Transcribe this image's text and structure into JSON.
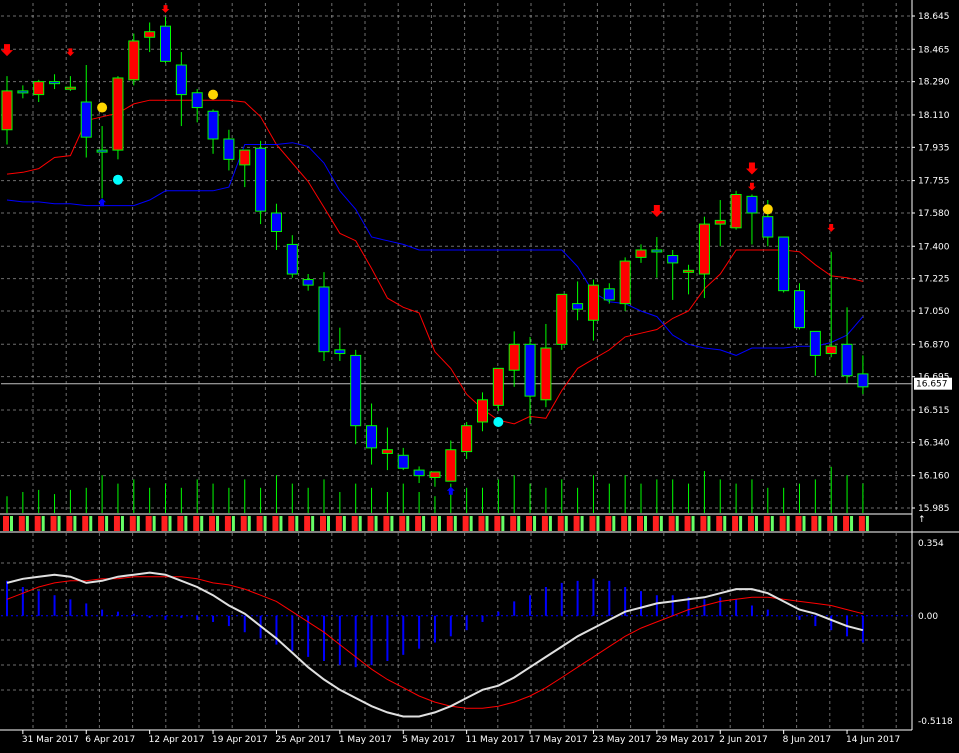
{
  "colors": {
    "background": "#000000",
    "grid": "#c8c8c8",
    "frame": "#ffffff",
    "bull_candle": "#ff0000",
    "bear_candle": "#0000ff",
    "wick": "#00ff00",
    "red_line": "#ff0000",
    "blue_line": "#0000ff",
    "volume": "#00ff00",
    "osc_signal": "#ffffff",
    "osc_histogram": "#0000ff",
    "up_arrow": "#0000ff",
    "down_arrow": "#ff0000",
    "yellow_dot": "#ffd700",
    "cyan_dot": "#00ffff"
  },
  "chart_data": [
    {
      "type": "candlestick",
      "panel": "price",
      "y_ticks": [
        "18.645",
        "18.465",
        "18.290",
        "18.110",
        "17.935",
        "17.755",
        "17.580",
        "17.400",
        "17.225",
        "17.050",
        "16.870",
        "16.695",
        "16.515",
        "16.340",
        "16.160",
        "15.985"
      ],
      "ylim": [
        15.985,
        18.645
      ],
      "current_price_label": "16.657",
      "candles": [
        {
          "o": 18.03,
          "h": 18.32,
          "c": 18.24,
          "l": 17.95
        },
        {
          "o": 18.24,
          "h": 18.27,
          "c": 18.23,
          "l": 18.2
        },
        {
          "o": 18.22,
          "h": 18.3,
          "c": 18.29,
          "l": 18.18
        },
        {
          "o": 18.29,
          "h": 18.33,
          "c": 18.28,
          "l": 18.25
        },
        {
          "o": 18.26,
          "h": 18.32,
          "c": 18.26,
          "l": 18.24
        },
        {
          "o": 18.18,
          "h": 18.38,
          "c": 17.99,
          "l": 17.88
        },
        {
          "o": 17.92,
          "h": 18.05,
          "c": 17.91,
          "l": 17.66
        },
        {
          "o": 17.92,
          "h": 18.32,
          "c": 18.31,
          "l": 17.87
        },
        {
          "o": 18.3,
          "h": 18.55,
          "c": 18.51,
          "l": 18.27
        },
        {
          "o": 18.53,
          "h": 18.61,
          "c": 18.56,
          "l": 18.45
        },
        {
          "o": 18.59,
          "h": 18.64,
          "c": 18.4,
          "l": 18.39
        },
        {
          "o": 18.38,
          "h": 18.45,
          "c": 18.22,
          "l": 18.05
        },
        {
          "o": 18.23,
          "h": 18.25,
          "c": 18.15,
          "l": 18.07
        },
        {
          "o": 18.13,
          "h": 18.14,
          "c": 17.98,
          "l": 17.9
        },
        {
          "o": 17.98,
          "h": 18.03,
          "c": 17.87,
          "l": 17.81
        },
        {
          "o": 17.84,
          "h": 17.88,
          "c": 17.92,
          "l": 17.72
        },
        {
          "o": 17.93,
          "h": 17.97,
          "c": 17.59,
          "l": 17.52
        },
        {
          "o": 17.58,
          "h": 17.63,
          "c": 17.48,
          "l": 17.38
        },
        {
          "o": 17.41,
          "h": 17.46,
          "c": 17.25,
          "l": 17.23
        },
        {
          "o": 17.22,
          "h": 17.25,
          "c": 17.19,
          "l": 17.16
        },
        {
          "o": 17.18,
          "h": 17.26,
          "c": 16.83,
          "l": 16.78
        },
        {
          "o": 16.84,
          "h": 16.96,
          "c": 16.82,
          "l": 16.78
        },
        {
          "o": 16.81,
          "h": 16.84,
          "c": 16.43,
          "l": 16.33
        },
        {
          "o": 16.43,
          "h": 16.55,
          "c": 16.31,
          "l": 16.22
        },
        {
          "o": 16.28,
          "h": 16.42,
          "c": 16.3,
          "l": 16.19
        },
        {
          "o": 16.27,
          "h": 16.31,
          "c": 16.2,
          "l": 16.19
        },
        {
          "o": 16.19,
          "h": 16.21,
          "c": 16.16,
          "l": 16.12
        },
        {
          "o": 16.15,
          "h": 16.17,
          "c": 16.18,
          "l": 16.1
        },
        {
          "o": 16.13,
          "h": 16.35,
          "c": 16.3,
          "l": 16.13
        },
        {
          "o": 16.29,
          "h": 16.45,
          "c": 16.43,
          "l": 16.25
        },
        {
          "o": 16.45,
          "h": 16.61,
          "c": 16.57,
          "l": 16.4
        },
        {
          "o": 16.54,
          "h": 16.71,
          "c": 16.74,
          "l": 16.51
        },
        {
          "o": 16.73,
          "h": 16.94,
          "c": 16.87,
          "l": 16.64
        },
        {
          "o": 16.87,
          "h": 16.91,
          "c": 16.59,
          "l": 16.44
        },
        {
          "o": 16.57,
          "h": 16.98,
          "c": 16.85,
          "l": 16.53
        },
        {
          "o": 16.87,
          "h": 17.12,
          "c": 17.14,
          "l": 16.84
        },
        {
          "o": 17.09,
          "h": 17.21,
          "c": 17.06,
          "l": 17.0
        },
        {
          "o": 17.0,
          "h": 17.22,
          "c": 17.19,
          "l": 16.89
        },
        {
          "o": 17.17,
          "h": 17.2,
          "c": 17.11,
          "l": 17.09
        },
        {
          "o": 17.09,
          "h": 17.34,
          "c": 17.32,
          "l": 17.05
        },
        {
          "o": 17.34,
          "h": 17.41,
          "c": 17.38,
          "l": 17.31
        },
        {
          "o": 17.38,
          "h": 17.45,
          "c": 17.37,
          "l": 17.23
        },
        {
          "o": 17.35,
          "h": 17.38,
          "c": 17.31,
          "l": 17.11
        },
        {
          "o": 17.27,
          "h": 17.3,
          "c": 17.27,
          "l": 17.14
        },
        {
          "o": 17.25,
          "h": 17.56,
          "c": 17.52,
          "l": 17.12
        },
        {
          "o": 17.52,
          "h": 17.65,
          "c": 17.54,
          "l": 17.4
        },
        {
          "o": 17.5,
          "h": 17.7,
          "c": 17.68,
          "l": 17.49
        },
        {
          "o": 17.67,
          "h": 17.68,
          "c": 17.58,
          "l": 17.41
        },
        {
          "o": 17.56,
          "h": 17.65,
          "c": 17.45,
          "l": 17.4
        },
        {
          "o": 17.45,
          "h": 17.45,
          "c": 17.16,
          "l": 17.15
        },
        {
          "o": 17.16,
          "h": 17.2,
          "c": 16.96,
          "l": 16.95
        },
        {
          "o": 16.94,
          "h": 16.94,
          "c": 16.81,
          "l": 16.7
        },
        {
          "o": 16.82,
          "h": 17.37,
          "c": 16.86,
          "l": 16.8
        },
        {
          "o": 16.87,
          "h": 17.07,
          "c": 16.7,
          "l": 16.66
        },
        {
          "o": 16.71,
          "h": 16.81,
          "c": 16.64,
          "l": 16.6
        }
      ],
      "red_line": [
        17.79,
        17.8,
        17.82,
        17.88,
        17.89,
        18.08,
        18.1,
        18.12,
        18.17,
        18.19,
        18.19,
        18.19,
        18.19,
        18.19,
        18.19,
        18.18,
        18.1,
        17.95,
        17.85,
        17.75,
        17.61,
        17.47,
        17.43,
        17.28,
        17.12,
        17.07,
        17.04,
        16.83,
        16.74,
        16.6,
        16.52,
        16.46,
        16.44,
        16.48,
        16.47,
        16.62,
        16.74,
        16.79,
        16.84,
        16.91,
        16.93,
        16.95,
        17.01,
        17.05,
        17.17,
        17.25,
        17.38,
        17.38,
        17.38,
        17.38,
        17.37,
        17.3,
        17.24,
        17.23,
        17.21
      ],
      "blue_line": [
        17.65,
        17.64,
        17.64,
        17.63,
        17.63,
        17.62,
        17.62,
        17.62,
        17.62,
        17.65,
        17.7,
        17.7,
        17.7,
        17.7,
        17.72,
        17.95,
        17.95,
        17.95,
        17.96,
        17.94,
        17.85,
        17.7,
        17.6,
        17.45,
        17.43,
        17.41,
        17.38,
        17.38,
        17.38,
        17.38,
        17.38,
        17.38,
        17.38,
        17.38,
        17.38,
        17.38,
        17.29,
        17.15,
        17.1,
        17.09,
        17.05,
        17.02,
        16.92,
        16.87,
        16.85,
        16.84,
        16.81,
        16.85,
        16.85,
        16.85,
        16.86,
        16.86,
        16.88,
        16.92,
        17.02
      ],
      "down_arrows": [
        {
          "i": 0,
          "size": "large"
        },
        {
          "i": 4,
          "size": "small"
        },
        {
          "i": 10,
          "size": "large"
        },
        {
          "i": 10,
          "size": "small",
          "offset": 1
        },
        {
          "i": 41,
          "size": "large"
        },
        {
          "i": 47,
          "size": "large"
        },
        {
          "i": 47,
          "size": "small",
          "offset": 1
        },
        {
          "i": 52,
          "size": "small"
        }
      ],
      "up_arrows": [
        {
          "i": 6,
          "value": 17.66
        },
        {
          "i": 28,
          "value": 16.1
        }
      ],
      "yellow_dots": [
        {
          "i": 6,
          "value": 18.15
        },
        {
          "i": 13,
          "value": 18.22
        },
        {
          "i": 48,
          "value": 17.6
        }
      ],
      "cyan_dots": [
        {
          "i": 7,
          "value": 17.76
        },
        {
          "i": 31,
          "value": 16.45
        }
      ]
    },
    {
      "type": "bar",
      "panel": "volume",
      "values": [
        0.4,
        0.5,
        0.55,
        0.45,
        0.55,
        0.6,
        0.9,
        0.7,
        0.8,
        0.6,
        0.7,
        0.6,
        0.8,
        0.7,
        0.6,
        0.8,
        0.6,
        0.9,
        0.7,
        0.6,
        0.8,
        0.5,
        0.7,
        0.6,
        0.5,
        0.7,
        0.5,
        0.4,
        0.7,
        0.6,
        0.6,
        0.8,
        0.9,
        0.7,
        0.6,
        0.8,
        0.6,
        0.9,
        0.7,
        0.9,
        0.7,
        0.8,
        0.8,
        0.7,
        1.0,
        0.8,
        0.7,
        0.8,
        0.6,
        0.6,
        0.7,
        0.8,
        1.1,
        0.9,
        0.7
      ]
    },
    {
      "type": "histogram_line",
      "panel": "oscillator",
      "y_ticks": [
        "0.354",
        "0.00",
        "-0.5118"
      ],
      "ylim": [
        -0.5118,
        0.354
      ],
      "histogram": [
        0.17,
        0.14,
        0.12,
        0.1,
        0.08,
        0.06,
        0.03,
        0.02,
        0.01,
        -0.01,
        -0.02,
        -0.01,
        -0.02,
        -0.03,
        -0.05,
        -0.08,
        -0.11,
        -0.14,
        -0.17,
        -0.2,
        -0.22,
        -0.24,
        -0.25,
        -0.24,
        -0.22,
        -0.19,
        -0.16,
        -0.13,
        -0.1,
        -0.07,
        -0.03,
        0.02,
        0.07,
        0.1,
        0.14,
        0.16,
        0.17,
        0.18,
        0.17,
        0.14,
        0.12,
        0.1,
        0.1,
        0.09,
        0.08,
        0.09,
        0.08,
        0.05,
        0.03,
        0.0,
        -0.02,
        -0.05,
        -0.07,
        -0.1,
        -0.13
      ],
      "signal_line": [
        0.16,
        0.18,
        0.19,
        0.2,
        0.19,
        0.16,
        0.17,
        0.19,
        0.2,
        0.21,
        0.2,
        0.17,
        0.14,
        0.1,
        0.05,
        0.01,
        -0.05,
        -0.11,
        -0.18,
        -0.25,
        -0.31,
        -0.36,
        -0.4,
        -0.44,
        -0.47,
        -0.49,
        -0.49,
        -0.47,
        -0.44,
        -0.4,
        -0.36,
        -0.34,
        -0.3,
        -0.25,
        -0.2,
        -0.15,
        -0.1,
        -0.06,
        -0.02,
        0.02,
        0.04,
        0.06,
        0.07,
        0.08,
        0.09,
        0.11,
        0.13,
        0.13,
        0.11,
        0.07,
        0.03,
        0.01,
        -0.02,
        -0.05,
        -0.07
      ],
      "red_line": [
        0.08,
        0.11,
        0.14,
        0.16,
        0.17,
        0.17,
        0.18,
        0.18,
        0.19,
        0.19,
        0.19,
        0.19,
        0.18,
        0.16,
        0.15,
        0.13,
        0.1,
        0.07,
        0.02,
        -0.03,
        -0.08,
        -0.14,
        -0.2,
        -0.26,
        -0.31,
        -0.35,
        -0.39,
        -0.42,
        -0.44,
        -0.45,
        -0.45,
        -0.44,
        -0.42,
        -0.39,
        -0.35,
        -0.3,
        -0.25,
        -0.2,
        -0.15,
        -0.1,
        -0.06,
        -0.03,
        0.0,
        0.03,
        0.05,
        0.07,
        0.08,
        0.09,
        0.09,
        0.08,
        0.07,
        0.06,
        0.05,
        0.03,
        0.01
      ]
    }
  ],
  "x_labels": [
    {
      "text": "31 Mar 2017",
      "i": 1
    },
    {
      "text": "6 Apr 2017",
      "i": 5
    },
    {
      "text": "12 Apr 2017",
      "i": 9
    },
    {
      "text": "19 Apr 2017",
      "i": 13
    },
    {
      "text": "25 Apr 2017",
      "i": 17
    },
    {
      "text": "1 May 2017",
      "i": 21
    },
    {
      "text": "5 May 2017",
      "i": 25
    },
    {
      "text": "11 May 2017",
      "i": 29
    },
    {
      "text": "17 May 2017",
      "i": 33
    },
    {
      "text": "23 May 2017",
      "i": 37
    },
    {
      "text": "29 May 2017",
      "i": 41
    },
    {
      "text": "2 Jun 2017",
      "i": 45
    },
    {
      "text": "8 Jun 2017",
      "i": 49
    },
    {
      "text": "14 Jun 2017",
      "i": 53
    }
  ]
}
